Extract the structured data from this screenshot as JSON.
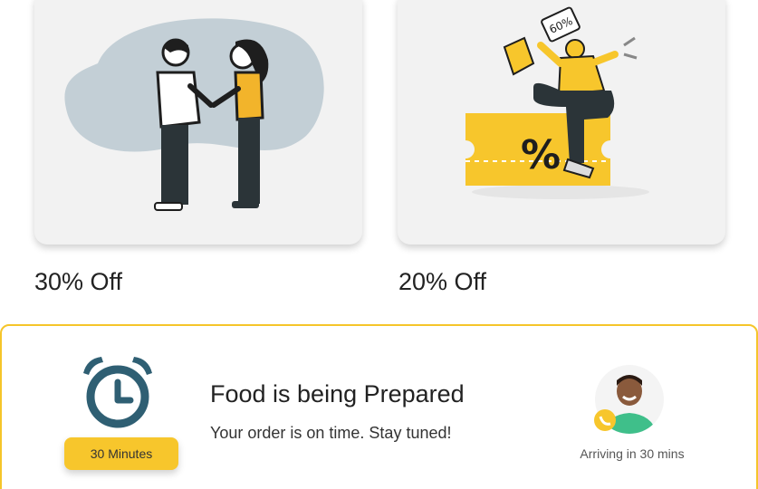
{
  "offers": [
    {
      "label": "30% Off",
      "illustration": "handshake-illustration"
    },
    {
      "label": "20% Off",
      "illustration": "shopping-discount-illustration",
      "tag_text": "60%",
      "ticket_text": "%"
    }
  ],
  "status": {
    "title": "Food is being Prepared",
    "subtitle": "Your order is on time. Stay tuned!",
    "time_chip": "30 Minutes",
    "arrival": "Arriving in 30 mins",
    "icons": [
      "alarm-clock-icon",
      "phone-icon"
    ]
  },
  "colors": {
    "accent_yellow": "#f7c62c",
    "panel_border": "#f5c52a",
    "clock_blue": "#2f5f73",
    "card_bg": "#f2f2f2"
  }
}
